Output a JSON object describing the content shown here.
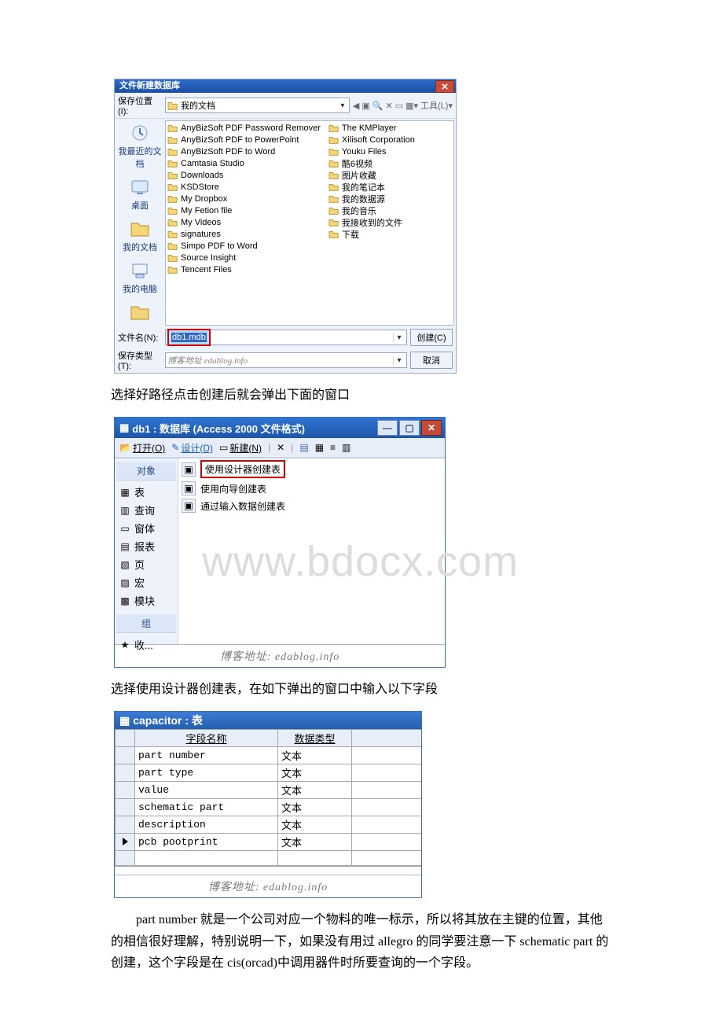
{
  "dialog_saveas": {
    "title": "文件新建数据库",
    "save_in_label": "保存位置(I):",
    "save_in_value": "我的文档",
    "tools_label": "工具(L)",
    "sidebar": [
      {
        "label": "我最近的文档",
        "icon": "recent-icon"
      },
      {
        "label": "桌面",
        "icon": "desktop-icon"
      },
      {
        "label": "我的文档",
        "icon": "mydocs-icon"
      },
      {
        "label": "我的电脑",
        "icon": "mycomputer-icon"
      }
    ],
    "files_col1": [
      "AnyBizSoft PDF Password Remover",
      "AnyBizSoft PDF to PowerPoint",
      "AnyBizSoft PDF to Word",
      "Camtasia Studio",
      "Downloads",
      "KSDStore",
      "My Dropbox",
      "My Fetion file",
      "My Videos",
      "signatures",
      "Simpo PDF to Word",
      "Source Insight",
      "Tencent Files"
    ],
    "files_col2": [
      "The KMPlayer",
      "Xilisoft Corporation",
      "Youku Files",
      "酷6视频",
      "图片收藏",
      "我的笔记本",
      "我的数据源",
      "我的音乐",
      "我接收到的文件",
      "下载"
    ],
    "filename_label": "文件名(N):",
    "filename_value": "db1.mdb",
    "filetype_label": "保存类型(T):",
    "filetype_overlay": "博客地址 edablog.info",
    "btn_create": "创建(C)",
    "btn_cancel": "取消"
  },
  "para1": "选择好路径点击创建后就会弹出下面的窗口",
  "dialog_db": {
    "title": "db1 : 数据库 (Access 2000 文件格式)",
    "toolbar": {
      "open": "打开(O)",
      "design": "设计(D)",
      "new": "新建(N)"
    },
    "nav_header_objects": "对象",
    "nav_items": [
      "表",
      "查询",
      "窗体",
      "报表",
      "页",
      "宏",
      "模块"
    ],
    "nav_header_groups": "组",
    "nav_group_item": "收...",
    "options": [
      "使用设计器创建表",
      "使用向导创建表",
      "通过输入数据创建表"
    ],
    "watermark": "www.bdocx.com",
    "footer": "博客地址:  edablog.info"
  },
  "para2": "选择使用设计器创建表，在如下弹出的窗口中输入以下字段",
  "dialog_table": {
    "title": "capacitor : 表",
    "col1": "字段名称",
    "col2": "数据类型",
    "rows": [
      {
        "name": "part number",
        "type": "文本"
      },
      {
        "name": "part type",
        "type": "文本"
      },
      {
        "name": "value",
        "type": "文本"
      },
      {
        "name": "schematic part",
        "type": "文本"
      },
      {
        "name": "description",
        "type": "文本"
      },
      {
        "name": "pcb pootprint",
        "type": "文本"
      }
    ],
    "footer": "博客地址:  edablog.info"
  },
  "para3": "part number 就是一个公司对应一个物料的唯一标示，所以将其放在主键的位置，其他的相信很好理解，特别说明一下，如果没有用过 allegro 的同学要注意一下 schematic part 的创建，这个字段是在 cis(orcad)中调用器件时所要查询的一个字段。"
}
